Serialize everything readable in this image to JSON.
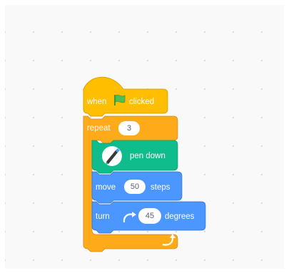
{
  "palette": {
    "events": "#ffbf00",
    "control": "#ffab19",
    "pen": "#0fbd8c",
    "motion": "#4c97ff",
    "input_text": "#575e75"
  },
  "blocks": {
    "hat": {
      "when_label": "when",
      "clicked_label": "clicked",
      "icon": "green-flag-icon"
    },
    "repeat": {
      "label": "repeat",
      "times": "3",
      "loop_icon": "loop-arrow-icon"
    },
    "pen_down": {
      "label": "pen down",
      "icon": "pen-icon"
    },
    "move": {
      "label": "move",
      "steps": "50",
      "unit": "steps"
    },
    "turn": {
      "label": "turn",
      "icon": "rotate-right-icon",
      "degrees": "45",
      "unit": "degrees"
    }
  }
}
